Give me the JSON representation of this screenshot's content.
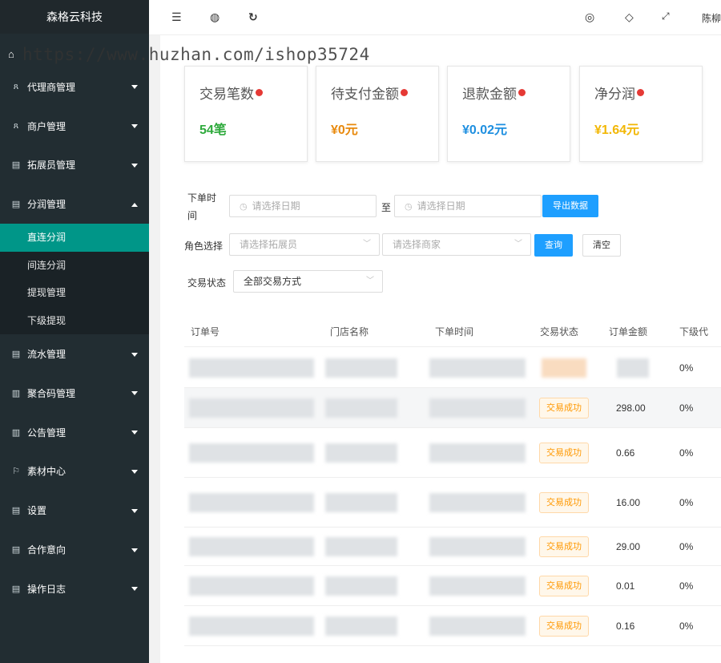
{
  "brand": "森格云科技",
  "watermark": "https://www.huzhan.com/ishop35724",
  "header": {
    "username": "陈柳"
  },
  "nav": [
    {
      "icon": "user-icon",
      "glyph": "ጸ",
      "label": "代理商管理",
      "expanded": false
    },
    {
      "icon": "user-icon",
      "glyph": "ጸ",
      "label": "商户管理",
      "expanded": false
    },
    {
      "icon": "doc-icon",
      "glyph": "▤",
      "label": "拓展员管理",
      "expanded": false
    },
    {
      "icon": "doc-icon",
      "glyph": "▤",
      "label": "分润管理",
      "expanded": true
    }
  ],
  "submenu": [
    "直连分润",
    "间连分润",
    "提现管理",
    "下级提现"
  ],
  "nav2": [
    {
      "icon": "doc-icon",
      "glyph": "▤",
      "label": "流水管理"
    },
    {
      "icon": "grid-icon",
      "glyph": "▥",
      "label": "聚合码管理"
    },
    {
      "icon": "grid-icon",
      "glyph": "▥",
      "label": "公告管理"
    },
    {
      "icon": "flag-icon",
      "glyph": "⚐",
      "label": "素材中心"
    },
    {
      "icon": "doc-icon",
      "glyph": "▤",
      "label": "设置"
    },
    {
      "icon": "doc-icon",
      "glyph": "▤",
      "label": "合作意向"
    },
    {
      "icon": "doc-icon",
      "glyph": "▤",
      "label": "操作日志"
    }
  ],
  "cards": [
    {
      "title": "交易笔数",
      "value": "54笔",
      "color": "#2eaa3c"
    },
    {
      "title": "待支付金额",
      "value": "¥0元",
      "color": "#e8890c"
    },
    {
      "title": "退款金额",
      "value": "¥0.02元",
      "color": "#1e8fe0"
    },
    {
      "title": "净分润",
      "value": "¥1.64元",
      "color": "#f2b705"
    }
  ],
  "filters": {
    "order_time_label": "下单时间",
    "date_placeholder": "请选择日期",
    "to": "至",
    "export": "导出数据",
    "role_label": "角色选择",
    "promoter_placeholder": "请选择拓展员",
    "merchant_placeholder": "请选择商家",
    "query": "查询",
    "clear": "清空",
    "status_label": "交易状态",
    "status_value": "全部交易方式"
  },
  "table": {
    "headers": [
      "订单号",
      "门店名称",
      "下单时间",
      "交易状态",
      "订单金额",
      "下级代"
    ],
    "rows": [
      {
        "status": "",
        "amount": "",
        "rate": "0%"
      },
      {
        "status": "交易成功",
        "amount": "298.00",
        "rate": "0%"
      },
      {
        "status": "交易成功",
        "amount": "0.66",
        "rate": "0%"
      },
      {
        "status": "交易成功",
        "amount": "16.00",
        "rate": "0%"
      },
      {
        "status": "交易成功",
        "amount": "29.00",
        "rate": "0%"
      },
      {
        "status": "交易成功",
        "amount": "0.01",
        "rate": "0%"
      },
      {
        "status": "交易成功",
        "amount": "0.16",
        "rate": "0%"
      }
    ]
  }
}
